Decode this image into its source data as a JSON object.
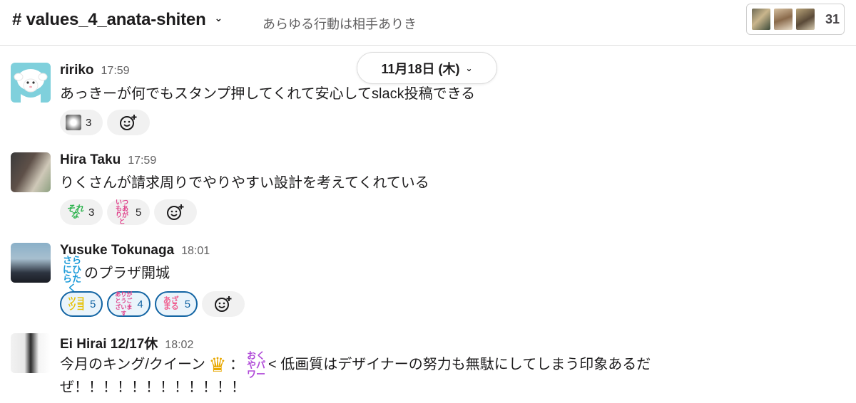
{
  "header": {
    "channel_name": "# values_4_anata-shiten",
    "topic": "あらゆる行動は相手ありき",
    "member_count": "31"
  },
  "date_divider": {
    "label": "11月18日 (木)"
  },
  "messages": [
    {
      "name": "ririko",
      "time": "17:59",
      "text": "あっきーが何でもスタンプ押してくれて安心してslack投稿できる",
      "reactions": [
        {
          "emoji_label": "",
          "count": "3"
        }
      ]
    },
    {
      "name": "Hira Taku",
      "time": "17:59",
      "text": "りくさんが請求周りでやりやすい設計を考えてくれている",
      "reactions": [
        {
          "emoji_label": "それな",
          "count": "3"
        },
        {
          "emoji_label": "いつもありがと",
          "count": "5"
        }
      ]
    },
    {
      "name": "Yusuke Tokunaga",
      "time": "18:01",
      "emoji_inline": "さらにひらたく",
      "text": "のプラザ開城",
      "reactions": [
        {
          "emoji_label": "ツヨツヨ",
          "count": "5"
        },
        {
          "emoji_label": "ありがとうございます",
          "count": "4"
        },
        {
          "emoji_label": "あざまる",
          "count": "5"
        }
      ]
    },
    {
      "name": "Ei Hirai 12/17休",
      "time": "18:02",
      "text_part1": "今月のキング/クイーン",
      "text_colon": "：",
      "emoji_inline2": "おくやパワー",
      "text_part2": "< 低画質はデザイナーの努力も無駄にしてしまう印象あるだ",
      "text_line2": "ぜ！！！！！！！！！！！！"
    }
  ],
  "colors": {
    "accent": "#1264a3",
    "text": "#1d1c1d",
    "muted": "#616061"
  }
}
